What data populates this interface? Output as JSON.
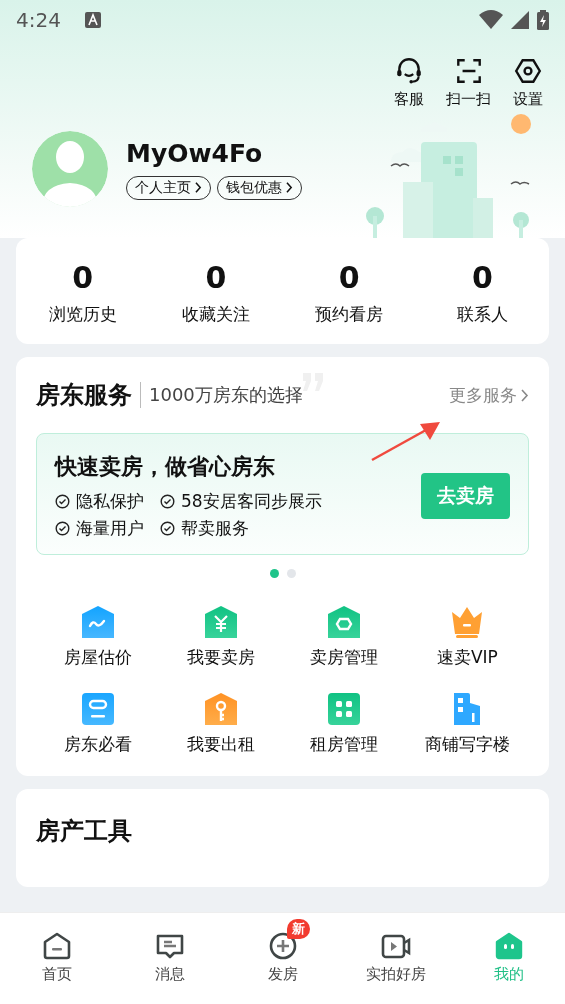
{
  "status_bar": {
    "time": "4:24"
  },
  "header_actions": [
    {
      "kind": "headset",
      "label": "客服"
    },
    {
      "kind": "scan",
      "label": "扫一扫"
    },
    {
      "kind": "settings",
      "label": "设置"
    }
  ],
  "profile": {
    "username": "MyOw4Fo",
    "links": [
      "个人主页",
      "钱包优惠"
    ]
  },
  "stats": [
    {
      "value": "0",
      "label": "浏览历史"
    },
    {
      "value": "0",
      "label": "收藏关注"
    },
    {
      "value": "0",
      "label": "预约看房"
    },
    {
      "value": "0",
      "label": "联系人"
    }
  ],
  "landlord_services": {
    "title": "房东服务",
    "subtitle": "1000万房东的选择",
    "more": "更多服务",
    "banner": {
      "title": "快速卖房，做省心房东",
      "features": [
        "隐私保护",
        "58安居客同步展示",
        "海量用户",
        "帮卖服务"
      ],
      "button": "去卖房"
    },
    "pager": [
      {
        "selected": true
      },
      {
        "selected": false
      }
    ],
    "items": [
      {
        "kind": "valuation",
        "label": "房屋估价"
      },
      {
        "kind": "sell",
        "label": "我要卖房"
      },
      {
        "kind": "manage",
        "label": "卖房管理"
      },
      {
        "kind": "vip",
        "label": "速卖VIP"
      },
      {
        "kind": "guide",
        "label": "房东必看"
      },
      {
        "kind": "rent",
        "label": "我要出租"
      },
      {
        "kind": "grid",
        "label": "租房管理"
      },
      {
        "kind": "office",
        "label": "商铺写字楼"
      }
    ]
  },
  "property_tools": {
    "title": "房产工具"
  },
  "bottom_nav": [
    {
      "kind": "home",
      "label": "首页",
      "selected": false
    },
    {
      "kind": "message",
      "label": "消息",
      "selected": false
    },
    {
      "kind": "post",
      "label": "发房",
      "selected": false,
      "badge": "新"
    },
    {
      "kind": "video",
      "label": "实拍好房",
      "selected": false
    },
    {
      "kind": "me",
      "label": "我的",
      "selected": true
    }
  ]
}
